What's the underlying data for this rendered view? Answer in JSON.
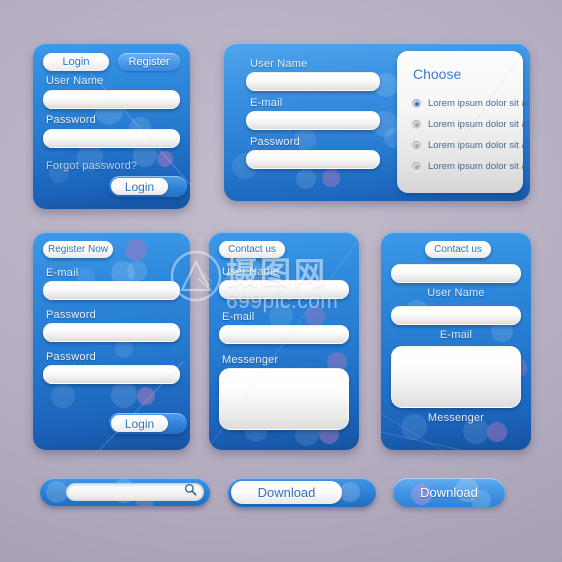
{
  "meta": {
    "theme_accent": "#2a7ed2",
    "background": "#b4adc0",
    "panel_blue_light": "#4fa6ec",
    "panel_blue_dark": "#15539f"
  },
  "login_panel": {
    "tab_login": "Login",
    "tab_register": "Register",
    "label_username": "User Name",
    "value_username": "",
    "placeholder_username": "",
    "label_password": "Password",
    "value_password": "",
    "placeholder_password": "",
    "forgot_link": "Forgot password?",
    "submit_label": "Login"
  },
  "signup_panel": {
    "label_username": "User Name",
    "value_username": "",
    "label_email": "E-mail",
    "value_email": "",
    "label_password": "Password",
    "value_password": "",
    "choose": {
      "title": "Choose",
      "options": [
        {
          "label": "Lorem ipsum dolor sit amet",
          "selected": true
        },
        {
          "label": "Lorem ipsum dolor sit amet",
          "selected": false
        },
        {
          "label": "Lorem ipsum dolor sit amet",
          "selected": false
        },
        {
          "label": "Lorem ipsum dolor sit amet",
          "selected": false
        }
      ]
    }
  },
  "register_panel": {
    "tab_label": "Register Now",
    "label_email": "E-mail",
    "value_email": "",
    "label_password_1": "Password",
    "value_password_1": "",
    "label_password_2": "Password",
    "value_password_2": "",
    "submit_label": "Login"
  },
  "contact_panel_a": {
    "tab_label": "Contact us",
    "label_username": "User Name",
    "value_username": "",
    "label_email": "E-mail",
    "value_email": "",
    "label_messenger": "Messenger",
    "value_messenger": ""
  },
  "contact_panel_b": {
    "tab_label": "Contact us",
    "value_username": "",
    "label_username": "User Name",
    "value_email": "",
    "label_email": "E-mail",
    "value_messenger": "",
    "label_messenger": "Messenger"
  },
  "bottom_bar": {
    "search_value": "",
    "search_placeholder": "",
    "search_icon": "magnifier-icon",
    "download_outline_label": "Download",
    "download_solid_label": "Download"
  },
  "watermark": {
    "cjk": "摄图网",
    "latin": "699pic.com"
  }
}
